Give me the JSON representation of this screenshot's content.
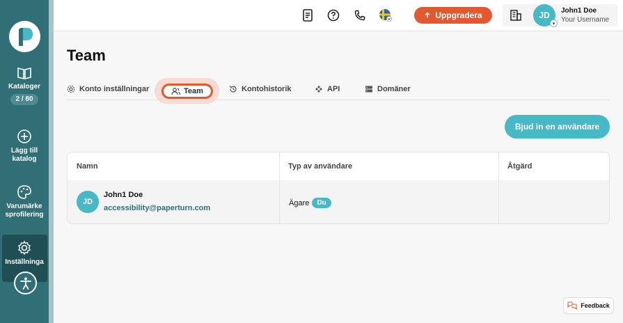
{
  "sidebar": {
    "items": [
      {
        "label": "Kataloger",
        "count": "2 / 80"
      },
      {
        "label": "Lägg till katalog"
      },
      {
        "label": "Varumärke sprofilering"
      },
      {
        "label": "Inställninga"
      }
    ]
  },
  "header": {
    "upgrade_label": "Uppgradera",
    "user_initials": "JD",
    "user_name": "John1 Doe",
    "user_sub": "Your Username"
  },
  "page": {
    "title": "Team",
    "tabs": [
      {
        "label": "Konto inställningar"
      },
      {
        "label": "Team"
      },
      {
        "label": "Kontohistorik"
      },
      {
        "label": "API"
      },
      {
        "label": "Domäner"
      }
    ],
    "invite_label": "Bjud in en användare"
  },
  "table": {
    "headers": [
      "Namn",
      "Typ av användare",
      "Åtgärd"
    ],
    "rows": [
      {
        "initials": "JD",
        "name": "John1 Doe",
        "email": "accessibility@paperturn.com",
        "role": "Ägare",
        "badge": "Du"
      }
    ]
  },
  "feedback_label": "Feedback",
  "colors": {
    "brand": "#2f6f75",
    "accent": "#e3592f",
    "teal": "#47b8c5"
  }
}
